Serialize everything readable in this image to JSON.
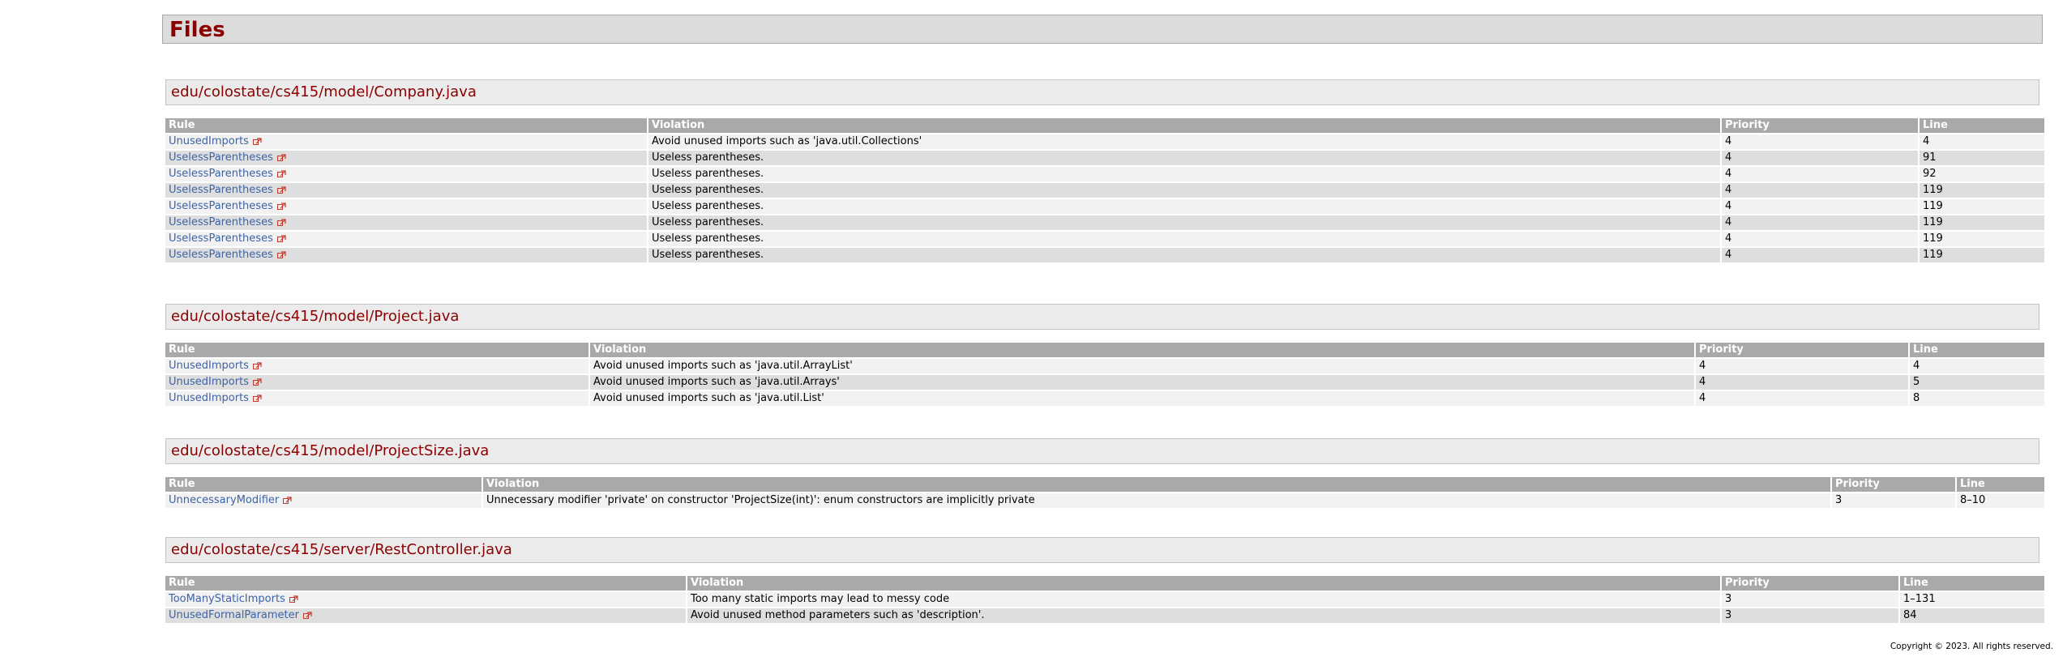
{
  "title": "Files",
  "copyright": "Copyright © 2023. All rights reserved.",
  "headers": {
    "rule": "Rule",
    "violation": "Violation",
    "priority": "Priority",
    "line": "Line"
  },
  "files": [
    {
      "path": "edu/colostate/cs415/model/Company.java",
      "rows": [
        {
          "rule": "UnusedImports",
          "violation": "Avoid unused imports such as 'java.util.Collections'",
          "priority": "4",
          "line": "4"
        },
        {
          "rule": "UselessParentheses",
          "violation": "Useless parentheses.",
          "priority": "4",
          "line": "91"
        },
        {
          "rule": "UselessParentheses",
          "violation": "Useless parentheses.",
          "priority": "4",
          "line": "92"
        },
        {
          "rule": "UselessParentheses",
          "violation": "Useless parentheses.",
          "priority": "4",
          "line": "119"
        },
        {
          "rule": "UselessParentheses",
          "violation": "Useless parentheses.",
          "priority": "4",
          "line": "119"
        },
        {
          "rule": "UselessParentheses",
          "violation": "Useless parentheses.",
          "priority": "4",
          "line": "119"
        },
        {
          "rule": "UselessParentheses",
          "violation": "Useless parentheses.",
          "priority": "4",
          "line": "119"
        },
        {
          "rule": "UselessParentheses",
          "violation": "Useless parentheses.",
          "priority": "4",
          "line": "119"
        }
      ]
    },
    {
      "path": "edu/colostate/cs415/model/Project.java",
      "rows": [
        {
          "rule": "UnusedImports",
          "violation": "Avoid unused imports such as 'java.util.ArrayList'",
          "priority": "4",
          "line": "4"
        },
        {
          "rule": "UnusedImports",
          "violation": "Avoid unused imports such as 'java.util.Arrays'",
          "priority": "4",
          "line": "5"
        },
        {
          "rule": "UnusedImports",
          "violation": "Avoid unused imports such as 'java.util.List'",
          "priority": "4",
          "line": "8"
        }
      ]
    },
    {
      "path": "edu/colostate/cs415/model/ProjectSize.java",
      "rows": [
        {
          "rule": "UnnecessaryModifier",
          "violation": "Unnecessary modifier 'private' on constructor 'ProjectSize(int)': enum constructors are implicitly private",
          "priority": "3",
          "line": "8–10"
        }
      ]
    },
    {
      "path": "edu/colostate/cs415/server/RestController.java",
      "rows": [
        {
          "rule": "TooManyStaticImports",
          "violation": "Too many static imports may lead to messy code",
          "priority": "3",
          "line": "1–131"
        },
        {
          "rule": "UnusedFormalParameter",
          "violation": "Avoid unused method parameters such as 'description'.",
          "priority": "3",
          "line": "84"
        }
      ]
    }
  ],
  "icons": {
    "external_link": "external-link-icon"
  },
  "colors": {
    "heading": "#8b0000",
    "link": "#3c63a8",
    "header_bg": "#a9a9a9",
    "row_light": "#f2f2f2",
    "row_dark": "#dedede"
  }
}
